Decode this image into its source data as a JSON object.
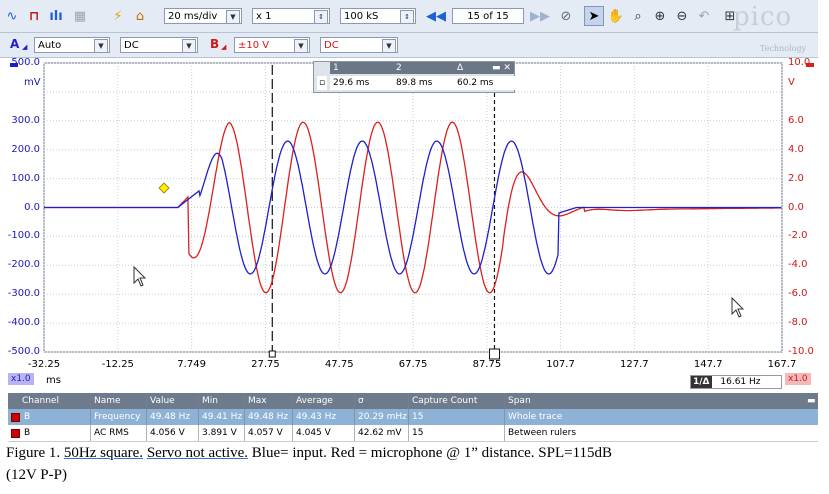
{
  "toolbar": {
    "timebase": "20 ms/div",
    "zoom": "x 1",
    "samples": "100 kS",
    "buffer": "15 of 15"
  },
  "channel_a": {
    "letter": "A",
    "range": "Auto",
    "coupling": "DC"
  },
  "channel_b": {
    "letter": "B",
    "range": "±10 V",
    "coupling": "DC"
  },
  "logo": {
    "text": "pico",
    "sub": "Technology"
  },
  "ruler_legend": {
    "headers": [
      "1",
      "2",
      "Δ"
    ],
    "values": [
      "29.6 ms",
      "89.8 ms",
      "60.2 ms"
    ]
  },
  "axes": {
    "left_unit": "mV",
    "right_unit": "V",
    "x_unit": "ms",
    "left_ticks": [
      "500.0",
      "400.0",
      "300.0",
      "200.0",
      "100.0",
      "0.0",
      "-100.0",
      "-200.0",
      "-300.0",
      "-400.0",
      "-500.0"
    ],
    "right_ticks": [
      "10.0",
      "8.0",
      "6.0",
      "4.0",
      "2.0",
      "0.0",
      "-2.0",
      "-4.0",
      "-6.0",
      "-8.0",
      "-10.0"
    ],
    "x_ticks": [
      "-32.25",
      "-12.25",
      "7.749",
      "27.75",
      "47.75",
      "67.75",
      "87.75",
      "107.7",
      "127.7",
      "147.7",
      "167.7"
    ],
    "left_zoom": "x1.0",
    "right_zoom": "x1.0",
    "freq_readout": "16.61 Hz",
    "freq_label": "1/Δ"
  },
  "chart_data": {
    "type": "line",
    "x_range": [
      -32.25,
      167.7
    ],
    "series": [
      {
        "color": "#1f1fcc",
        "axis": "left",
        "ylim": [
          -500,
          500
        ]
      },
      {
        "color": "#dd1f1f",
        "axis": "right",
        "ylim": [
          -10,
          10
        ]
      }
    ],
    "rulers_x": [
      29.6,
      89.8
    ]
  },
  "table": {
    "headers": [
      "Channel",
      "Name",
      "Value",
      "Min",
      "Max",
      "Average",
      "σ",
      "Capture Count",
      "Span"
    ],
    "rows": [
      [
        "B",
        "Frequency",
        "49.48 Hz",
        "49.41 Hz",
        "49.48 Hz",
        "49.43 Hz",
        "20.29 mHz",
        "15",
        "Whole trace"
      ],
      [
        "B",
        "AC RMS",
        "4.056 V",
        "3.891 V",
        "4.057 V",
        "4.045 V",
        "42.62 mV",
        "15",
        "Between rulers"
      ]
    ]
  },
  "caption": {
    "prefix": "Figure 1.  ",
    "part1": "50Hz square.",
    "part2": " ",
    "part3": "Servo not active.",
    "part4": " Blue= input. Red = microphone @ 1” distance.   SPL=115dB",
    "line2": "(12V P-P)"
  },
  "colors": {
    "blue_trace": "#1f1fcc",
    "red_trace": "#dd1f1f",
    "toolbar_bg": "#e4ebf5",
    "selected_row": "#8db2d6"
  }
}
